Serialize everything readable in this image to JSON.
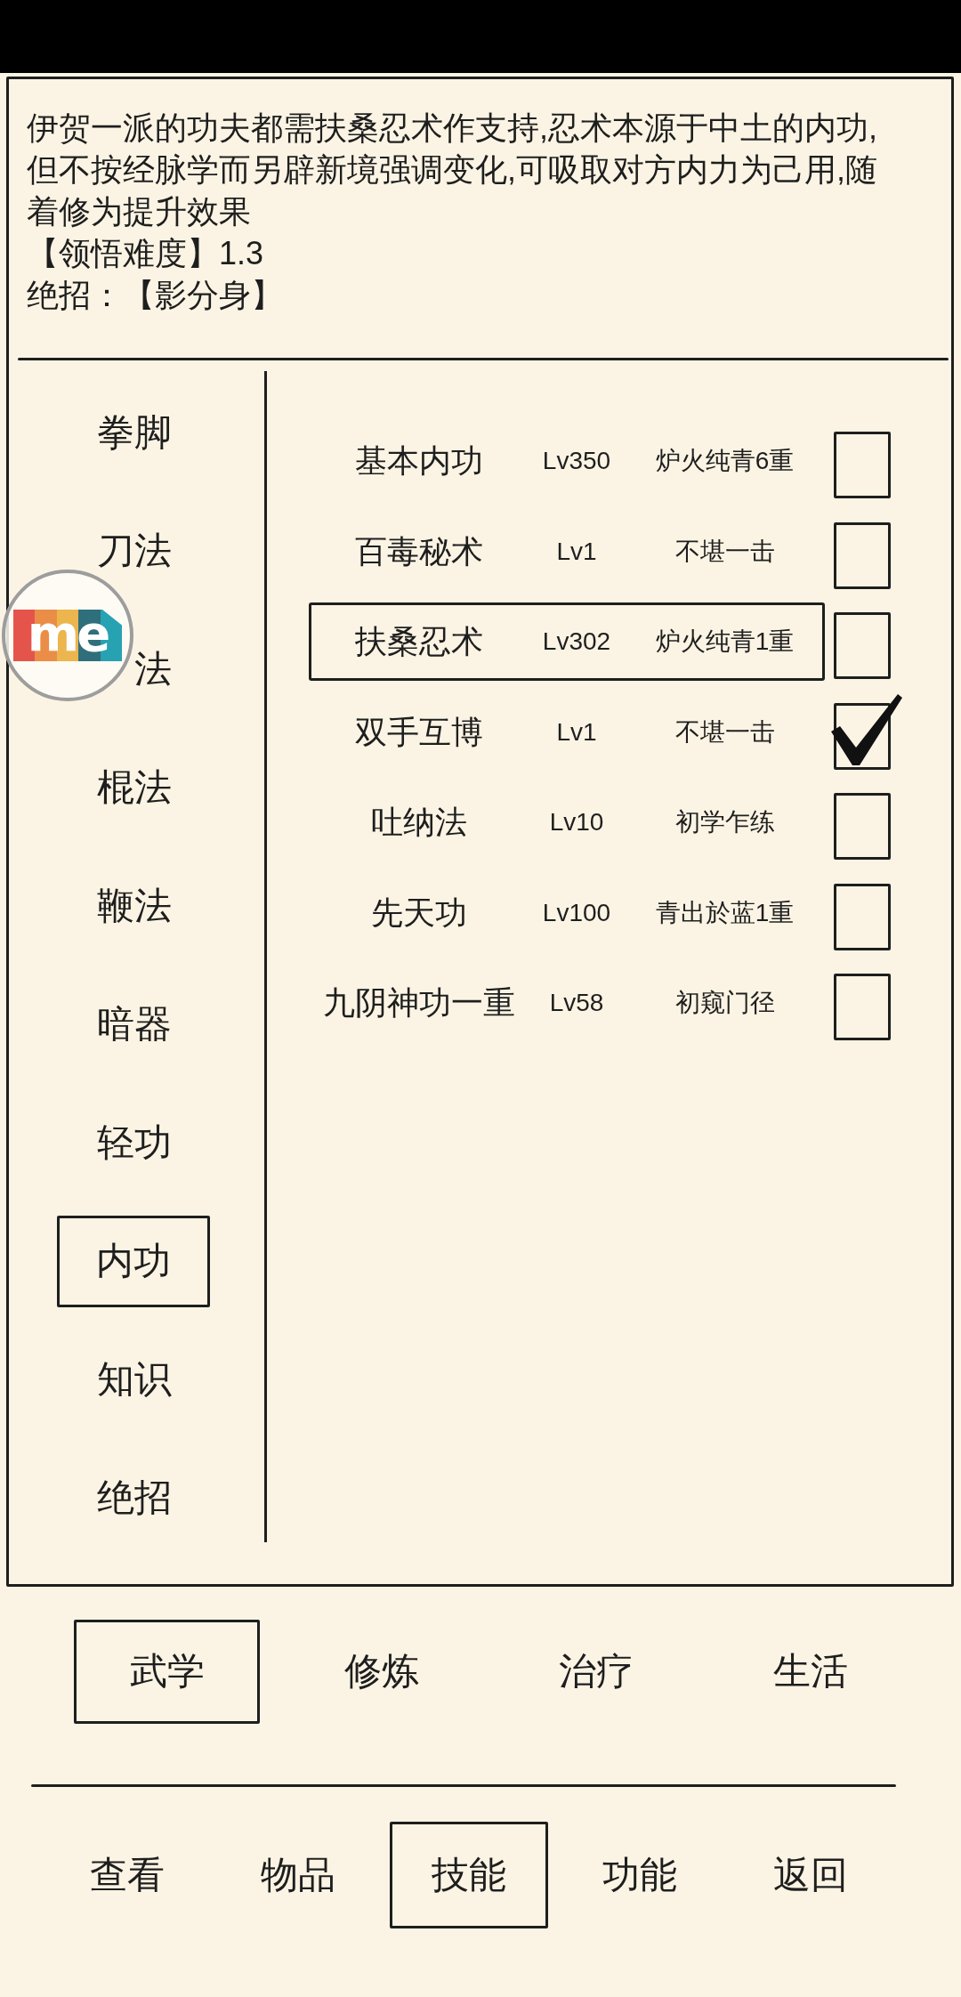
{
  "description": {
    "text": "伊贺一派的功夫都需扶桑忍术作支持,忍术本源于中土的内功,但不按经脉学而另辟新境强调变化,可吸取对方内力为己用,随着修为提升效果",
    "difficulty": "【领悟难度】1.3",
    "signature_move": "绝招：【影分身】"
  },
  "categories": [
    {
      "label": "拳脚",
      "selected": false
    },
    {
      "label": "刀法",
      "selected": false
    },
    {
      "label": "法",
      "selected": false
    },
    {
      "label": "棍法",
      "selected": false
    },
    {
      "label": "鞭法",
      "selected": false
    },
    {
      "label": "暗器",
      "selected": false
    },
    {
      "label": "轻功",
      "selected": false
    },
    {
      "label": "内功",
      "selected": true
    },
    {
      "label": "知识",
      "selected": false
    },
    {
      "label": "绝招",
      "selected": false
    }
  ],
  "skills": [
    {
      "name": "基本内功",
      "lv": "Lv350",
      "rank": "炉火纯青6重",
      "selected": false,
      "checked": false
    },
    {
      "name": "百毒秘术",
      "lv": "Lv1",
      "rank": "不堪一击",
      "selected": false,
      "checked": false
    },
    {
      "name": "扶桑忍术",
      "lv": "Lv302",
      "rank": "炉火纯青1重",
      "selected": true,
      "checked": false
    },
    {
      "name": "双手互博",
      "lv": "Lv1",
      "rank": "不堪一击",
      "selected": false,
      "checked": true
    },
    {
      "name": "吐纳法",
      "lv": "Lv10",
      "rank": "初学乍练",
      "selected": false,
      "checked": false
    },
    {
      "name": "先天功",
      "lv": "Lv100",
      "rank": "青出於蓝1重",
      "selected": false,
      "checked": false
    },
    {
      "name": "九阴神功一重",
      "lv": "Lv58",
      "rank": "初窥门径",
      "selected": false,
      "checked": false
    }
  ],
  "tabs": [
    {
      "label": "武学",
      "selected": true
    },
    {
      "label": "修炼",
      "selected": false
    },
    {
      "label": "治疗",
      "selected": false
    },
    {
      "label": "生活",
      "selected": false
    }
  ],
  "nav": [
    {
      "label": "查看",
      "selected": false
    },
    {
      "label": "物品",
      "selected": false
    },
    {
      "label": "技能",
      "selected": true
    },
    {
      "label": "功能",
      "selected": false
    },
    {
      "label": "返回",
      "selected": false
    }
  ],
  "floating_button": {
    "label": "me"
  }
}
